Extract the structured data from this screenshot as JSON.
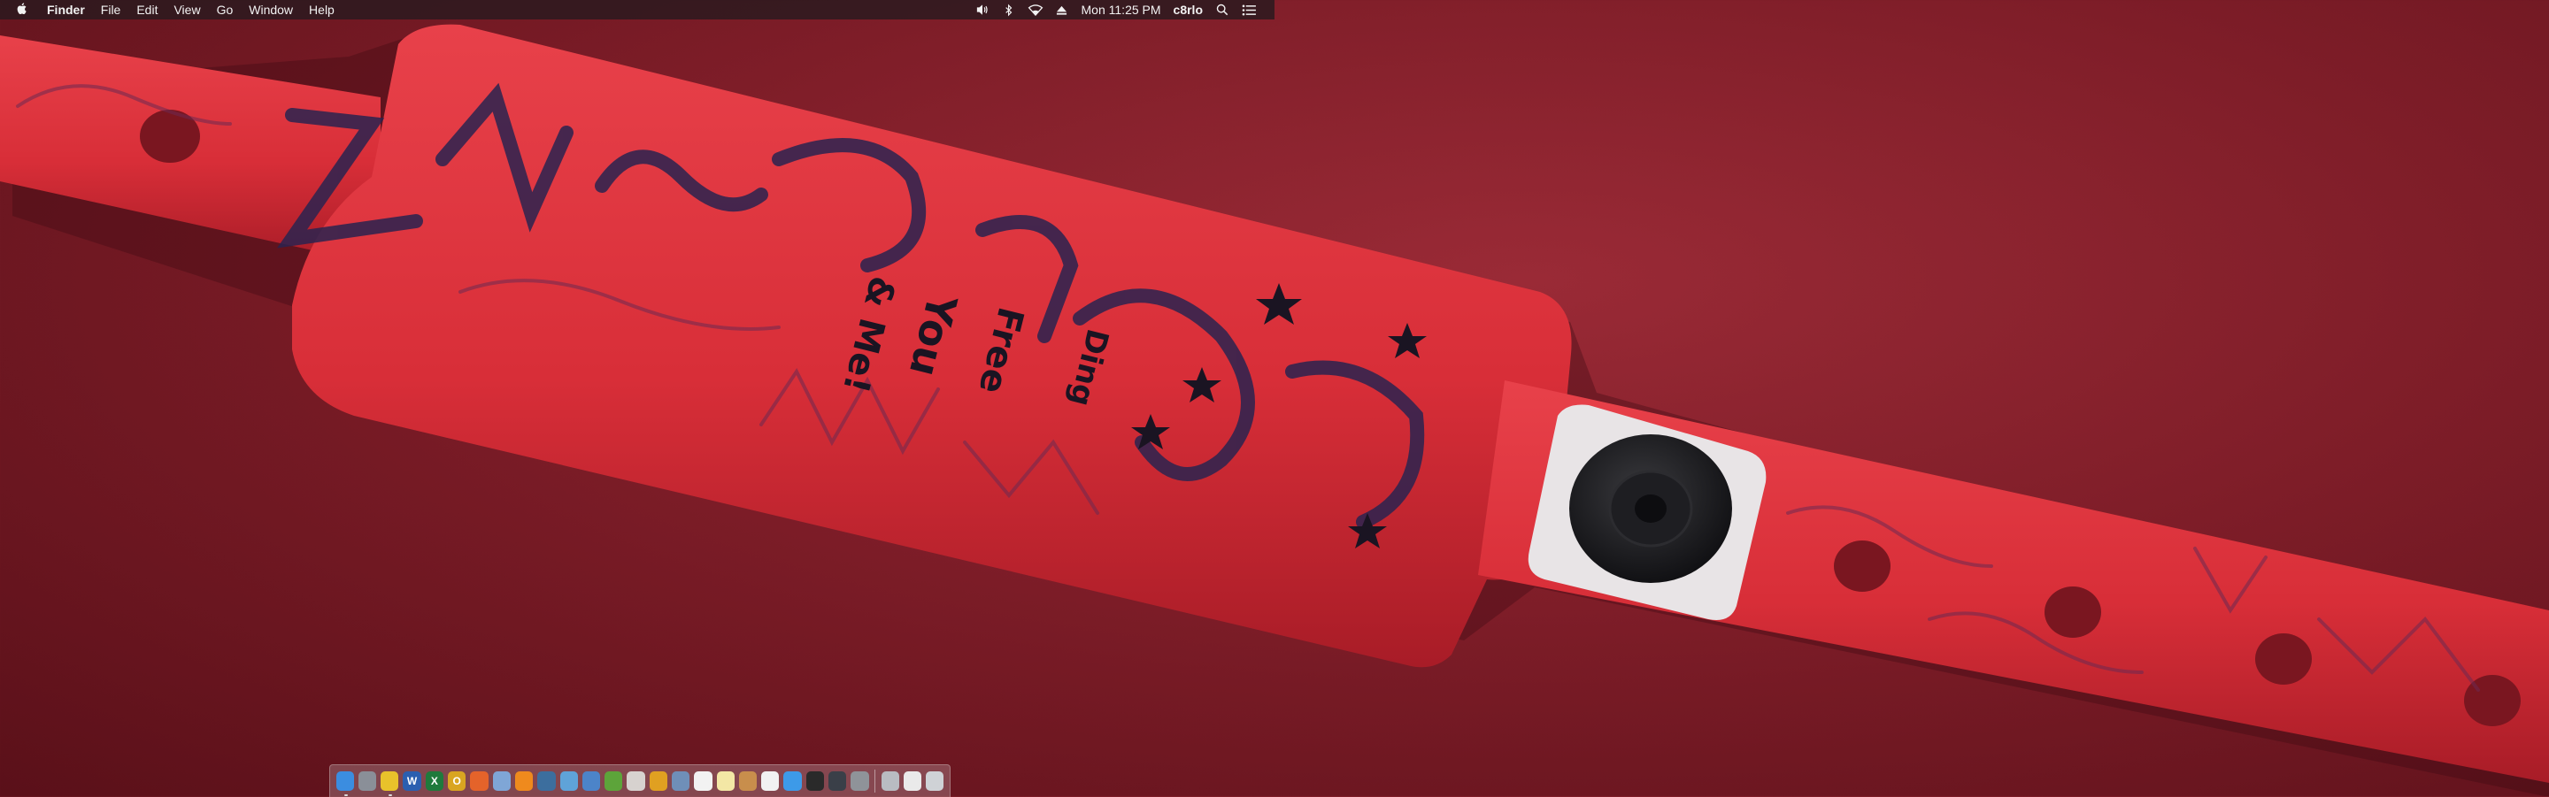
{
  "menubar": {
    "app_name": "Finder",
    "menus": [
      "File",
      "Edit",
      "View",
      "Go",
      "Window",
      "Help"
    ],
    "status": {
      "icons": [
        "volume-icon",
        "bluetooth-icon",
        "wifi-icon",
        "eject-icon"
      ],
      "clock": "Mon 11:25 PM",
      "user": "c8rlo",
      "extras": [
        "spotlight-icon",
        "notification-center-icon"
      ]
    }
  },
  "wallpaper": {
    "subject": "red festival wristband",
    "printed_text": [
      "You",
      "& Me!",
      "Free",
      "Ding"
    ],
    "colors": {
      "band": "#e0313b",
      "band_dark": "#b51f2b",
      "ink": "#2a2350",
      "clasp": "#1c1c1e",
      "tab": "#e8e4e6"
    }
  },
  "dock": {
    "apps": [
      {
        "name": "finder-icon",
        "color": "#3b8de0",
        "glyph": "",
        "running": true
      },
      {
        "name": "launchpad-icon",
        "color": "#8a8f98",
        "glyph": "",
        "running": false
      },
      {
        "name": "chrome-icon",
        "color": "#e8c22b",
        "glyph": "",
        "running": true
      },
      {
        "name": "word-icon",
        "color": "#2b5fb0",
        "glyph": "W",
        "running": false
      },
      {
        "name": "excel-icon",
        "color": "#1f7a3c",
        "glyph": "X",
        "running": false
      },
      {
        "name": "outlook-icon",
        "color": "#d9a521",
        "glyph": "O",
        "running": false
      },
      {
        "name": "firefox-icon",
        "color": "#e4632a",
        "glyph": "",
        "running": false
      },
      {
        "name": "folder-icon",
        "color": "#7fa6d6",
        "glyph": "",
        "running": false
      },
      {
        "name": "vlc-icon",
        "color": "#ef8a1d",
        "glyph": "",
        "running": false
      },
      {
        "name": "steam-icon",
        "color": "#3c6e9e",
        "glyph": "",
        "running": false
      },
      {
        "name": "safari-icon",
        "color": "#5fa3d8",
        "glyph": "",
        "running": false
      },
      {
        "name": "xcode-icon",
        "color": "#4c84c9",
        "glyph": "",
        "running": false
      },
      {
        "name": "torrent-icon",
        "color": "#5da43a",
        "glyph": "",
        "running": false
      },
      {
        "name": "itunes-icon",
        "color": "#d7d2cf",
        "glyph": "",
        "running": false
      },
      {
        "name": "photo-app-icon",
        "color": "#e0a021",
        "glyph": "",
        "running": false
      },
      {
        "name": "preview-icon",
        "color": "#6f8fb8",
        "glyph": "",
        "running": false
      },
      {
        "name": "calendar-icon",
        "color": "#f2f2f2",
        "glyph": "",
        "running": false
      },
      {
        "name": "notes-icon",
        "color": "#f3e7a5",
        "glyph": "",
        "running": false
      },
      {
        "name": "books-icon",
        "color": "#c88e4c",
        "glyph": "",
        "running": false
      },
      {
        "name": "music-icon",
        "color": "#f2f2f2",
        "glyph": "",
        "running": false
      },
      {
        "name": "app-store-icon",
        "color": "#3d9ae8",
        "glyph": "",
        "running": false
      },
      {
        "name": "terminal-icon",
        "color": "#2a2a2a",
        "glyph": "",
        "running": false
      },
      {
        "name": "activity-monitor-icon",
        "color": "#3a3f48",
        "glyph": "",
        "running": false
      },
      {
        "name": "system-preferences-icon",
        "color": "#8f9399",
        "glyph": "",
        "running": false
      }
    ],
    "trailing": [
      {
        "name": "downloads-stack-icon",
        "color": "#b9bcc2",
        "glyph": ""
      },
      {
        "name": "mail-stack-icon",
        "color": "#eaeaea",
        "glyph": ""
      },
      {
        "name": "trash-icon",
        "color": "#cfd2d6",
        "glyph": ""
      }
    ]
  }
}
